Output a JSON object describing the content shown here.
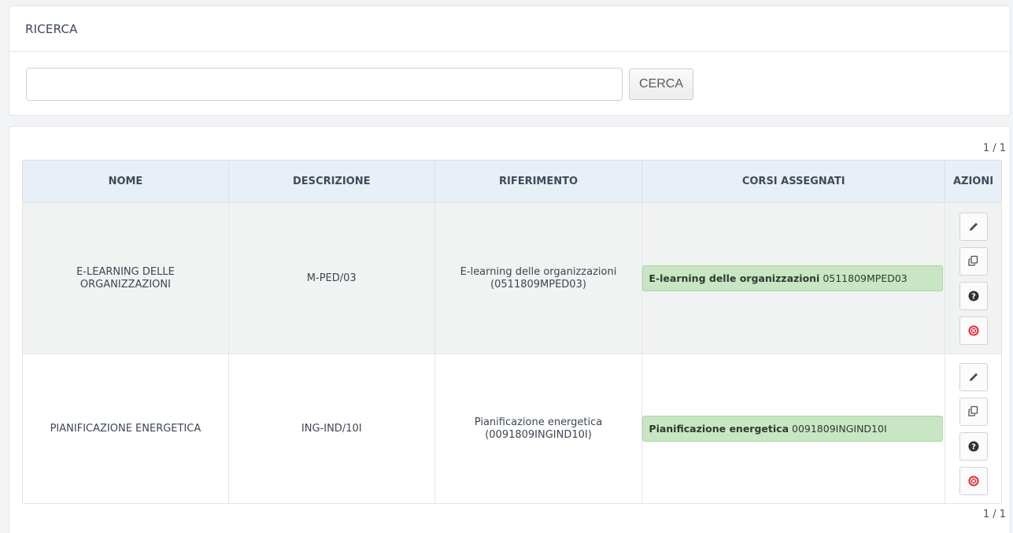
{
  "search": {
    "title": "RICERCA",
    "input_value": "",
    "input_placeholder": "",
    "button_label": "CERCA"
  },
  "pagination": {
    "top": "1 / 1",
    "bottom": "1 / 1"
  },
  "table": {
    "columns": [
      "NOME",
      "DESCRIZIONE",
      "RIFERIMENTO",
      "CORSI ASSEGNATI",
      "AZIONI"
    ],
    "rows": [
      {
        "nome": "E-LEARNING DELLE ORGANIZZAZIONI",
        "descrizione": "M-PED/03",
        "riferimento_line1": "E-learning delle organizzazioni",
        "riferimento_line2": "(0511809MPED03)",
        "corso_nome": "E-learning delle organizzazioni",
        "corso_codice": "0511809MPED03"
      },
      {
        "nome": "PIANIFICAZIONE ENERGETICA",
        "descrizione": "ING-IND/10I",
        "riferimento_line1": "Pianificazione energetica",
        "riferimento_line2": "(0091809INGIND10I)",
        "corso_nome": "Pianificazione energetica",
        "corso_codice": "0091809INGIND10I"
      }
    ]
  },
  "action_icons": [
    "pencil-icon",
    "copy-icon",
    "question-icon",
    "delete-icon"
  ],
  "colors": {
    "badge_bg": "#c8e6c3",
    "header_bg": "#e8eff6",
    "delete_red": "#e0242d"
  }
}
